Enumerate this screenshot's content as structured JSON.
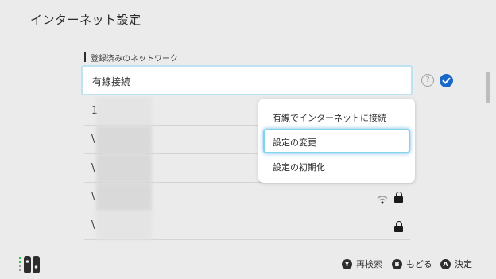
{
  "header": {
    "title": "インターネット設定"
  },
  "section": {
    "label": "登録済みのネットワーク"
  },
  "selected_row": {
    "label": "有線接続"
  },
  "rows": [
    {
      "initial": "1"
    },
    {
      "initial": "\\"
    },
    {
      "initial": "\\"
    },
    {
      "initial": "\\"
    },
    {
      "initial": "\\"
    }
  ],
  "context_menu": {
    "items": [
      {
        "label": "有線でインターネットに接続"
      },
      {
        "label": "設定の変更"
      },
      {
        "label": "設定の初期化"
      }
    ]
  },
  "footer": {
    "hints": [
      {
        "button": "Y",
        "label": "再検索"
      },
      {
        "button": "B",
        "label": "もどる"
      },
      {
        "button": "A",
        "label": "決定"
      }
    ]
  },
  "icons": {
    "help": "help-icon",
    "check": "check-icon",
    "wifi": "wifi-icon",
    "lock": "lock-icon",
    "controller": "joycon-icon"
  },
  "colors": {
    "accent": "#1868c8",
    "focus": "#7fd6ea"
  }
}
